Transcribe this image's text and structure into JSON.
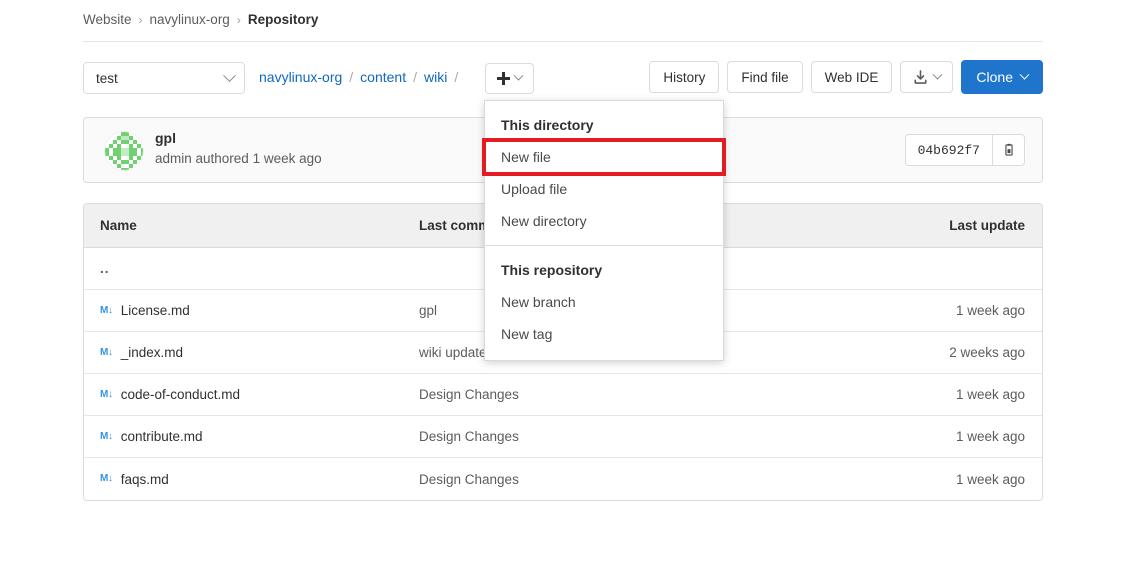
{
  "breadcrumb": {
    "items": [
      {
        "label": "Website",
        "current": false
      },
      {
        "label": "navylinux-org",
        "current": false
      },
      {
        "label": "Repository",
        "current": true
      }
    ],
    "separator": "›"
  },
  "toolbar": {
    "branch_selector": {
      "value": "test",
      "icon": "chevron-down-icon"
    },
    "path": {
      "segments": [
        "navylinux-org",
        "content",
        "wiki"
      ],
      "separator": "/",
      "trailing_separator": "/"
    },
    "add_button": {
      "label": "+",
      "icon": "plus-icon",
      "chevron": "chevron-down-icon"
    },
    "history_label": "History",
    "find_file_label": "Find file",
    "web_ide_label": "Web IDE",
    "download_button": {
      "icon": "download-icon",
      "chevron": "chevron-down-icon"
    },
    "clone_label": "Clone"
  },
  "dropdown": {
    "sections": [
      {
        "header": "This directory",
        "items": [
          {
            "label": "New file",
            "highlighted": true
          },
          {
            "label": "Upload file",
            "highlighted": false
          },
          {
            "label": "New directory",
            "highlighted": false
          }
        ]
      },
      {
        "header": "This repository",
        "items": [
          {
            "label": "New branch",
            "highlighted": false
          },
          {
            "label": "New tag",
            "highlighted": false
          }
        ]
      }
    ],
    "highlight_color": "#e31b23"
  },
  "commit": {
    "title": "gpl",
    "meta": "admin authored 1 week ago",
    "sha": "04b692f7",
    "copy_icon": "clipboard-copy-icon",
    "avatar": "identicon-avatar"
  },
  "table": {
    "headers": {
      "name": "Name",
      "last_commit": "Last commit",
      "last_update": "Last update"
    },
    "parent_row": {
      "name": "..",
      "last_commit": "",
      "last_update": ""
    },
    "rows": [
      {
        "icon": "markdown-file-icon",
        "name": "License.md",
        "last_commit": "gpl",
        "last_update": "1 week ago"
      },
      {
        "icon": "markdown-file-icon",
        "name": "_index.md",
        "last_commit": "wiki update cc",
        "last_update": "2 weeks ago"
      },
      {
        "icon": "markdown-file-icon",
        "name": "code-of-conduct.md",
        "last_commit": "Design Changes",
        "last_update": "1 week ago"
      },
      {
        "icon": "markdown-file-icon",
        "name": "contribute.md",
        "last_commit": "Design Changes",
        "last_update": "1 week ago"
      },
      {
        "icon": "markdown-file-icon",
        "name": "faqs.md",
        "last_commit": "Design Changes",
        "last_update": "1 week ago"
      }
    ]
  },
  "colors": {
    "accent": "#1f75cb",
    "link": "#1068bf",
    "highlight": "#e31b23",
    "markdown_icon": "#3793e0",
    "identicon_green": "#6fd16f"
  }
}
